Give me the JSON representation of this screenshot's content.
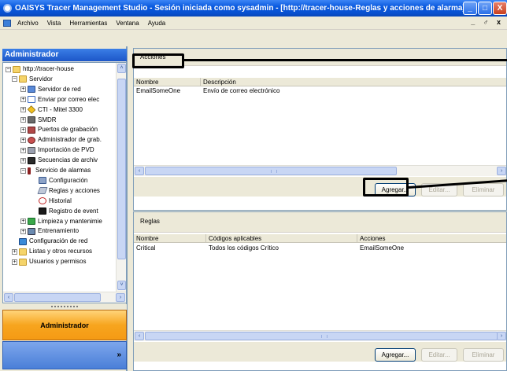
{
  "window": {
    "title": "OAISYS Tracer Management Studio - Sesión iniciada como sysadmin - [http://tracer-house-Reglas y acciones de alarma]",
    "minimize": "_",
    "maximize": "□",
    "close": "X"
  },
  "menubar": {
    "items": [
      "Archivo",
      "Vista",
      "Herramientas",
      "Ventana",
      "Ayuda"
    ],
    "mdi_controls": "_ ♂ x"
  },
  "leftpane": {
    "header": "Administrador",
    "tree": [
      {
        "label": "http://tracer-house",
        "expander": "−",
        "icon": "folder-icon",
        "level": 0
      },
      {
        "label": "Servidor",
        "expander": "−",
        "icon": "folder-icon",
        "level": 1
      },
      {
        "label": "Servidor de red",
        "expander": "+",
        "icon": "network-server-icon",
        "level": 2
      },
      {
        "label": "Enviar por correo elec",
        "expander": "+",
        "icon": "email-icon",
        "level": 2
      },
      {
        "label": "CTI - Mitel 3300",
        "expander": "+",
        "icon": "cti-icon",
        "level": 2
      },
      {
        "label": "SMDR",
        "expander": "+",
        "icon": "smdr-icon",
        "level": 2
      },
      {
        "label": "Puertos de grabación",
        "expander": "+",
        "icon": "recording-ports-icon",
        "level": 2
      },
      {
        "label": "Administrador de grab.",
        "expander": "+",
        "icon": "recording-admin-icon",
        "level": 2
      },
      {
        "label": "Importación de PVD",
        "expander": "+",
        "icon": "pvd-import-icon",
        "level": 2
      },
      {
        "label": "Secuencias de archiv",
        "expander": "+",
        "icon": "archive-sequences-icon",
        "level": 2
      },
      {
        "label": "Servicio de alarmas",
        "expander": "−",
        "icon": "alarm-service-icon",
        "level": 2
      },
      {
        "label": "Configuración",
        "expander": "",
        "icon": "configuration-icon",
        "level": 3
      },
      {
        "label": "Reglas y acciones",
        "expander": "",
        "icon": "rules-actions-icon",
        "level": 3
      },
      {
        "label": "Historial",
        "expander": "",
        "icon": "history-icon",
        "level": 3
      },
      {
        "label": "Registro de event",
        "expander": "",
        "icon": "event-log-icon",
        "level": 3
      },
      {
        "label": "Limpieza y mantenimie",
        "expander": "+",
        "icon": "cleanup-icon",
        "level": 2
      },
      {
        "label": "Entrenamiento",
        "expander": "+",
        "icon": "training-icon",
        "level": 2
      },
      {
        "label": "Configuración de red",
        "expander": "",
        "icon": "network-config-icon",
        "level": 1
      },
      {
        "label": "Listas y otros recursos",
        "expander": "+",
        "icon": "folder-icon",
        "level": 1
      },
      {
        "label": "Usuarios y permisos",
        "expander": "+",
        "icon": "folder-icon",
        "level": 1
      }
    ],
    "nav_button": "Administrador",
    "footer_chevron": "»"
  },
  "actions_panel": {
    "title": "Acciones",
    "columns": [
      "Nombre",
      "Descripción"
    ],
    "rows": [
      [
        "EmailSomeOne",
        "Envío de correo electrónico"
      ]
    ],
    "buttons": {
      "add": "Agregar...",
      "edit": "Editar...",
      "delete": "Eliminar"
    }
  },
  "rules_panel": {
    "title": "Reglas",
    "columns": [
      "Nombre",
      "Códigos aplicables",
      "Acciones"
    ],
    "rows": [
      [
        "Critical",
        "Todos los códigos Crítico",
        "EmailSomeOne"
      ]
    ],
    "buttons": {
      "add": "Agregar...",
      "edit": "Editar...",
      "delete": "Eliminar"
    }
  },
  "scroll": {
    "left": "‹",
    "right": "›",
    "up": "˄",
    "down": "˅",
    "grip": "III"
  }
}
